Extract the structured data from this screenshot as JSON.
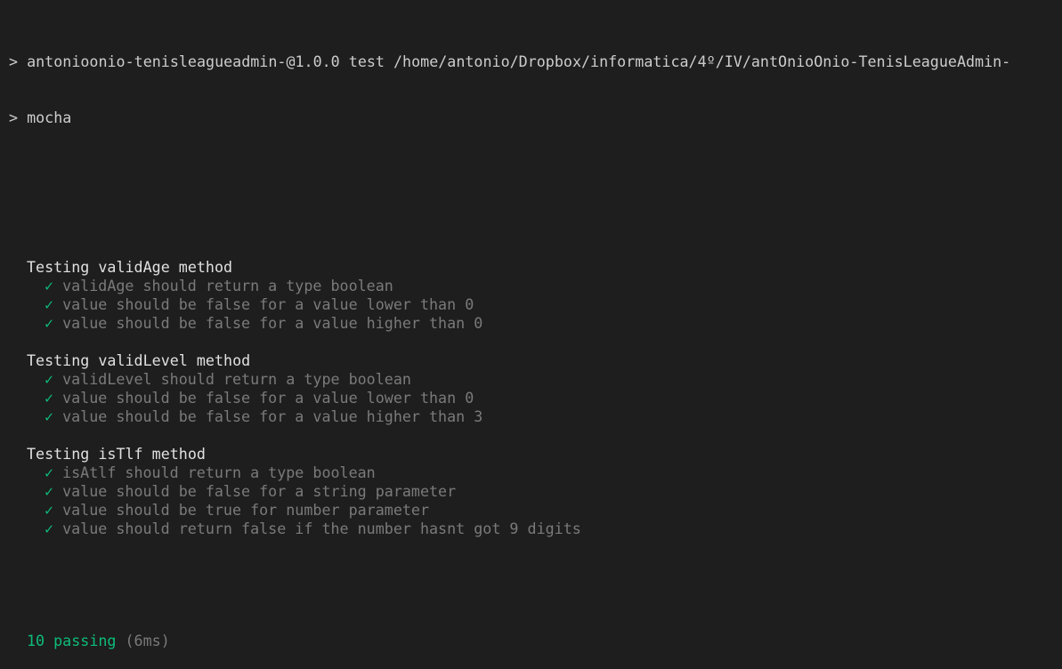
{
  "command_lines": [
    "> antonioonio-tenisleagueadmin-@1.0.0 test /home/antonio/Dropbox/informatica/4º/IV/antOnioOnio-TenisLeagueAdmin-",
    "> mocha"
  ],
  "check_glyph": "✓",
  "suites": [
    {
      "title": "Testing validAge method",
      "tests": [
        "validAge should return a type boolean",
        "value should be false for a value lower than 0",
        "value should be false for a value higher than 0"
      ]
    },
    {
      "title": "Testing validLevel method",
      "tests": [
        "validLevel should return a type boolean",
        "value should be false for a value lower than 0",
        "value should be false for a value higher than 3"
      ]
    },
    {
      "title": "Testing isTlf method",
      "tests": [
        "isAtlf should return a type boolean",
        "value should be false for a string parameter",
        "value should be true for number parameter",
        "value should return false if the number hasnt got 9 digits"
      ]
    }
  ],
  "summary": {
    "passing": "10 passing",
    "duration": "(6ms)"
  },
  "colors": {
    "background": "#1e1e1e",
    "pass": "#0dbc79",
    "muted": "#7a7a7a"
  }
}
